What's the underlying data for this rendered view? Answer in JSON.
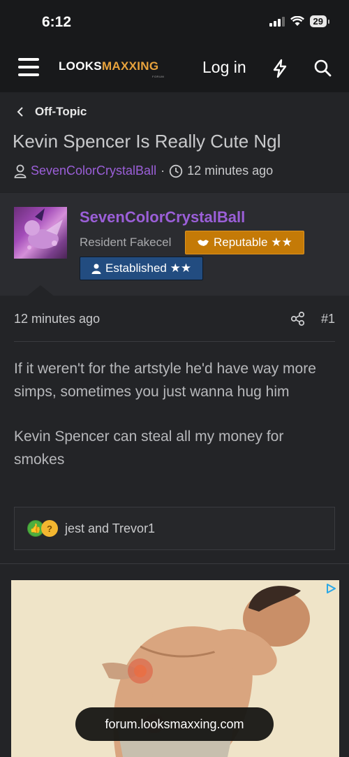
{
  "status_bar": {
    "time": "6:12",
    "battery": "29"
  },
  "nav": {
    "logo_main": "LOOKS",
    "logo_accent": "MAXXING",
    "logo_sub": "FORUM",
    "login_label": "Log in",
    "bolt_icon": "bolt-icon",
    "search_icon": "search-icon"
  },
  "breadcrumb": {
    "label": "Off-Topic"
  },
  "thread": {
    "title": "Kevin Spencer Is Really Cute Ngl",
    "author": "SevenColorCrystalBall",
    "separator": "·",
    "time": "12 minutes ago"
  },
  "user": {
    "name": "SevenColorCrystalBall",
    "title": "Resident Fakecel",
    "badges": [
      {
        "label": "Reputable ★★",
        "color": "#c47a07"
      },
      {
        "label": "Established ★★",
        "color": "#224c80"
      }
    ]
  },
  "post": {
    "time": "12 minutes ago",
    "number": "#1",
    "paragraphs": [
      "If it weren't for the artstyle he'd have way more simps, sometimes you just wanna hug him",
      "Kevin Spencer can steal all my money for smokes"
    ],
    "reactions_text": "jest and Trevor1"
  },
  "url_bar": {
    "domain": "forum.looksmaxxing.com"
  },
  "colors": {
    "username": "#9b5fd8",
    "accent": "#e8a33d",
    "background": "#232427"
  }
}
